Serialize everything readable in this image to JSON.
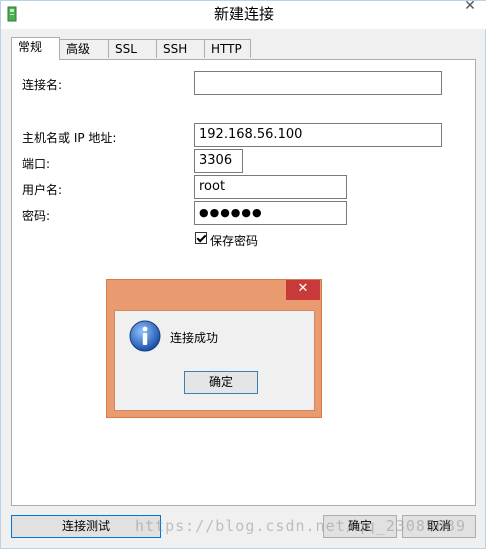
{
  "window": {
    "title": "新建连接",
    "close_glyph": "✕"
  },
  "tabs": [
    {
      "label": "常规",
      "active": true
    },
    {
      "label": "高级"
    },
    {
      "label": "SSL"
    },
    {
      "label": "SSH"
    },
    {
      "label": "HTTP"
    }
  ],
  "form": {
    "connection_name": {
      "label": "连接名:",
      "value": ""
    },
    "host": {
      "label": "主机名或 IP 地址:",
      "value": "192.168.56.100"
    },
    "port": {
      "label": "端口:",
      "value": "3306"
    },
    "username": {
      "label": "用户名:",
      "value": "root"
    },
    "password": {
      "label": "密码:",
      "value": "●●●●●●"
    },
    "save_password": {
      "label": "保存密码",
      "checked": true
    }
  },
  "dialog": {
    "close_glyph": "✕",
    "message": "连接成功",
    "ok_label": "确定",
    "icon": "info-icon"
  },
  "buttons": {
    "test": "连接测试",
    "ok": "确定",
    "cancel": "取消"
  },
  "watermark": "https://blog.csdn.net/qq_23089839",
  "colors": {
    "dialog_frame": "#e99a6e",
    "dialog_close": "#c83a3a",
    "focus_border": "#0078d7"
  }
}
